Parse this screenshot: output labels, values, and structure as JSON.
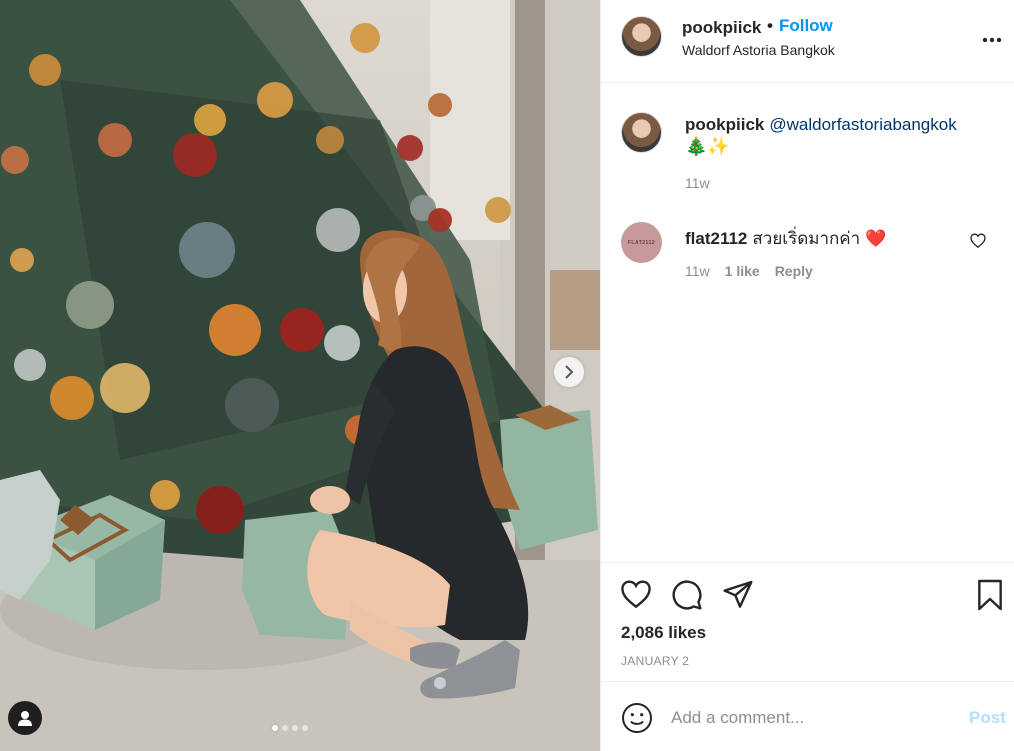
{
  "post": {
    "username": "pookpiick",
    "follow_label": "Follow",
    "separator": "•",
    "location": "Waldorf Astoria Bangkok"
  },
  "caption": {
    "username": "pookpiick",
    "mention": "@waldorfastoriabangkok",
    "emoji": "🎄✨",
    "time": "11w"
  },
  "comments": [
    {
      "username": "flat2112",
      "avatar_text": "FLAT2112",
      "text": "สวยเริ่ดมากค่า ❤️",
      "time": "11w",
      "likes": "1 like",
      "reply": "Reply"
    }
  ],
  "engagement": {
    "likes": "2,086 likes",
    "date": "JANUARY 2"
  },
  "comment_box": {
    "placeholder": "Add a comment...",
    "post_label": "Post"
  },
  "carousel": {
    "current": 1,
    "total": 4
  },
  "colors": {
    "accent": "#0095f6",
    "post_disabled": "#b2dffc",
    "secondary_text": "#8e8e8e",
    "border": "#efefef",
    "heart_red": "#e0102c"
  }
}
